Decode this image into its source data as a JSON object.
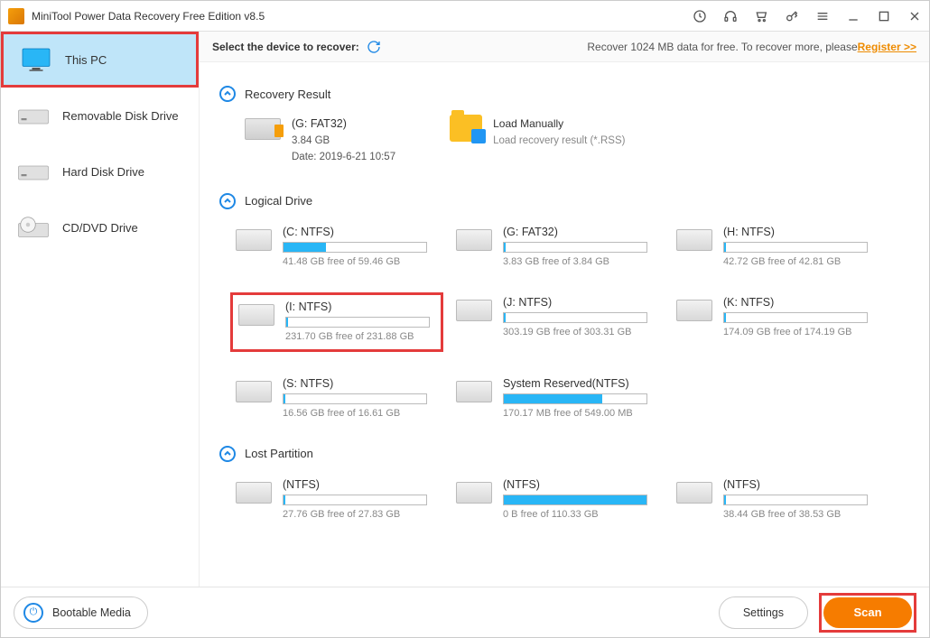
{
  "title": "MiniTool Power Data Recovery Free Edition v8.5",
  "sidebar": [
    {
      "label": "This PC",
      "selected": true,
      "icon": "monitor"
    },
    {
      "label": "Removable Disk Drive",
      "selected": false,
      "icon": "drive"
    },
    {
      "label": "Hard Disk Drive",
      "selected": false,
      "icon": "drive"
    },
    {
      "label": "CD/DVD Drive",
      "selected": false,
      "icon": "cd"
    }
  ],
  "header": {
    "select_label": "Select the device to recover:",
    "recover_text": "Recover 1024 MB data for free. To recover more, please ",
    "register": "Register >>"
  },
  "sections": {
    "recovery": {
      "title": "Recovery Result",
      "item": {
        "name": "(G: FAT32)",
        "size": "3.84 GB",
        "date": "Date: 2019-6-21 10:57"
      },
      "load": {
        "title": "Load Manually",
        "sub": "Load recovery result (*.RSS)"
      }
    },
    "logical": {
      "title": "Logical Drive",
      "drives": [
        {
          "name": "(C: NTFS)",
          "free": "41.48 GB free of 59.46 GB",
          "fill": 30,
          "hl": false
        },
        {
          "name": "(G: FAT32)",
          "free": "3.83 GB free of 3.84 GB",
          "fill": 1,
          "hl": false
        },
        {
          "name": "(H: NTFS)",
          "free": "42.72 GB free of 42.81 GB",
          "fill": 1,
          "hl": false
        },
        {
          "name": "(I: NTFS)",
          "free": "231.70 GB free of 231.88 GB",
          "fill": 1,
          "hl": true
        },
        {
          "name": "(J: NTFS)",
          "free": "303.19 GB free of 303.31 GB",
          "fill": 1,
          "hl": false
        },
        {
          "name": "(K: NTFS)",
          "free": "174.09 GB free of 174.19 GB",
          "fill": 1,
          "hl": false
        },
        {
          "name": "(S: NTFS)",
          "free": "16.56 GB free of 16.61 GB",
          "fill": 1,
          "hl": false
        },
        {
          "name": "System Reserved(NTFS)",
          "free": "170.17 MB free of 549.00 MB",
          "fill": 69,
          "hl": false
        }
      ]
    },
    "lost": {
      "title": "Lost Partition",
      "drives": [
        {
          "name": "(NTFS)",
          "free": "27.76 GB free of 27.83 GB",
          "fill": 1,
          "hl": false
        },
        {
          "name": "(NTFS)",
          "free": "0 B free of 110.33 GB",
          "fill": 100,
          "hl": false
        },
        {
          "name": "(NTFS)",
          "free": "38.44 GB free of 38.53 GB",
          "fill": 1,
          "hl": false
        }
      ]
    }
  },
  "footer": {
    "bootable": "Bootable Media",
    "settings": "Settings",
    "scan": "Scan"
  }
}
